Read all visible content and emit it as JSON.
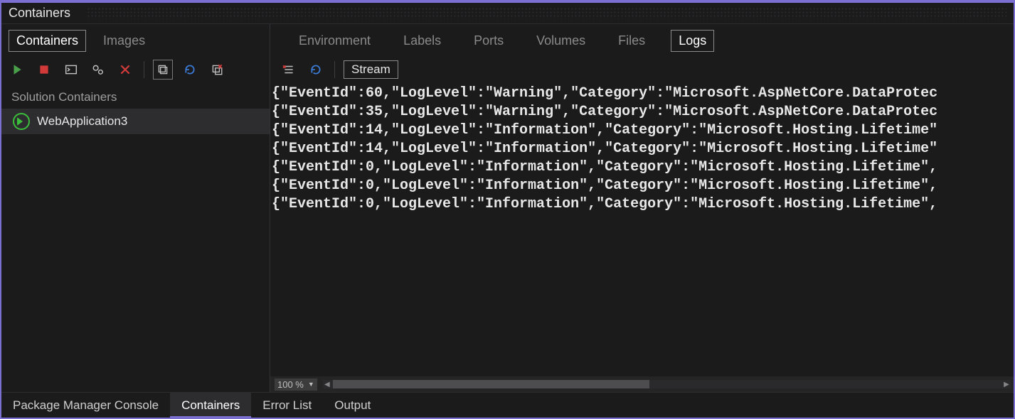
{
  "panel_title": "Containers",
  "left": {
    "subtabs": [
      {
        "label": "Containers",
        "active": true
      },
      {
        "label": "Images",
        "active": false
      }
    ],
    "section_label": "Solution Containers",
    "items": [
      {
        "name": "WebApplication3",
        "status": "running"
      }
    ]
  },
  "right": {
    "tabs": [
      {
        "label": "Environment",
        "active": false
      },
      {
        "label": "Labels",
        "active": false
      },
      {
        "label": "Ports",
        "active": false
      },
      {
        "label": "Volumes",
        "active": false
      },
      {
        "label": "Files",
        "active": false
      },
      {
        "label": "Logs",
        "active": true
      }
    ],
    "stream_label": "Stream",
    "zoom": "100 %",
    "logs": [
      "{\"EventId\":60,\"LogLevel\":\"Warning\",\"Category\":\"Microsoft.AspNetCore.DataProtec",
      "{\"EventId\":35,\"LogLevel\":\"Warning\",\"Category\":\"Microsoft.AspNetCore.DataProtec",
      "{\"EventId\":14,\"LogLevel\":\"Information\",\"Category\":\"Microsoft.Hosting.Lifetime\"",
      "{\"EventId\":14,\"LogLevel\":\"Information\",\"Category\":\"Microsoft.Hosting.Lifetime\"",
      "{\"EventId\":0,\"LogLevel\":\"Information\",\"Category\":\"Microsoft.Hosting.Lifetime\",",
      "{\"EventId\":0,\"LogLevel\":\"Information\",\"Category\":\"Microsoft.Hosting.Lifetime\",",
      "{\"EventId\":0,\"LogLevel\":\"Information\",\"Category\":\"Microsoft.Hosting.Lifetime\","
    ]
  },
  "bottom_tabs": [
    {
      "label": "Package Manager Console",
      "active": false
    },
    {
      "label": "Containers",
      "active": true
    },
    {
      "label": "Error List",
      "active": false
    },
    {
      "label": "Output",
      "active": false
    }
  ]
}
